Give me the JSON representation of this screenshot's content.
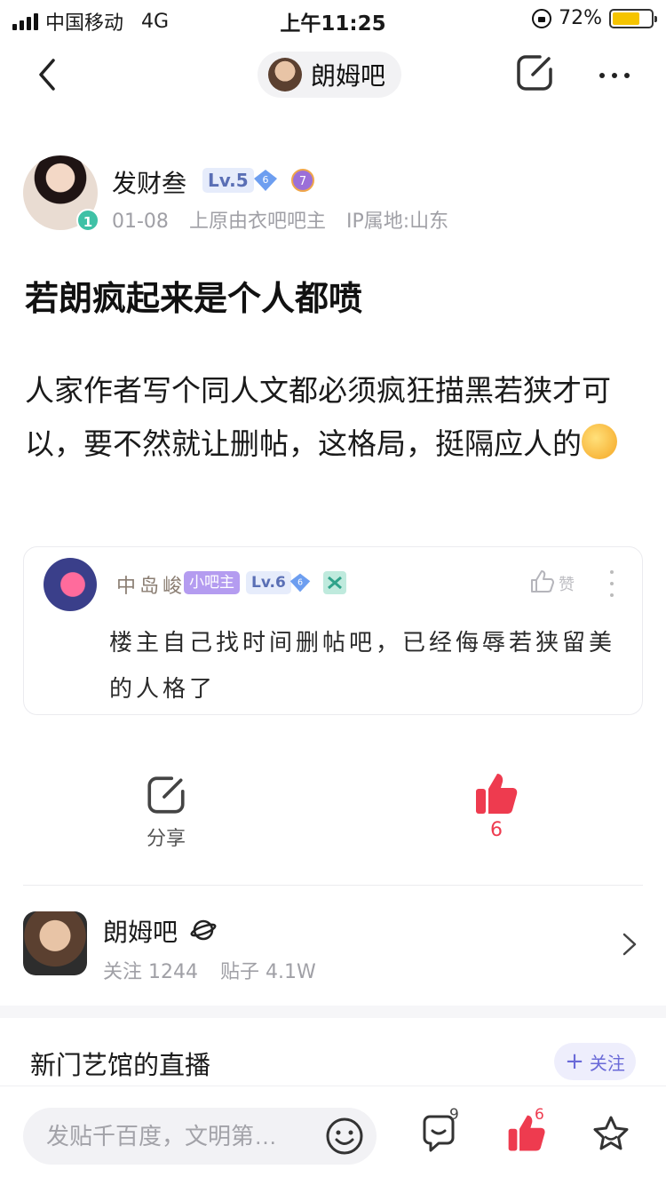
{
  "status_bar": {
    "carrier": "中国移动",
    "network": "4G",
    "time": "上午11:25",
    "battery": "72%",
    "battery_level": 0.72
  },
  "nav": {
    "forum_name": "朗姆吧",
    "icons": [
      "back-icon",
      "edit-icon",
      "more-icon"
    ]
  },
  "author": {
    "name": "发财叁",
    "level": "Lv.5",
    "gem_badge": "6",
    "rank_badge": "7",
    "avatar_level": "1",
    "date": "01-08",
    "role": "上原由衣吧吧主",
    "ip": "IP属地:山东"
  },
  "post": {
    "title": "若朗疯起来是个人都喷",
    "body": "人家作者写个同人文都必须疯狂描黑若狭才可以，要不然就让删帖，这格局，挺隔应人的"
  },
  "comment": {
    "name": "中岛峻",
    "role_tag": "小吧主",
    "level": "Lv.6",
    "gem_badge": "6",
    "like_label": "赞",
    "text": "楼主自己找时间删帖吧，已经侮辱若狭留美的人格了"
  },
  "actions": {
    "share_label": "分享",
    "like_count": "6"
  },
  "forum_card": {
    "name": "朗姆吧",
    "follow_stat": "关注 1244",
    "post_stat": "贴子 4.1W"
  },
  "live": {
    "title": "新门艺馆的直播",
    "follow_label": "关注"
  },
  "bottom_bar": {
    "placeholder": "发贴千百度，文明第…",
    "comment_count": "9",
    "like_count": "6"
  },
  "colors": {
    "accent_red": "#ee3b4f",
    "accent_purple": "#6a6ad8",
    "battery": "#f5c400"
  }
}
